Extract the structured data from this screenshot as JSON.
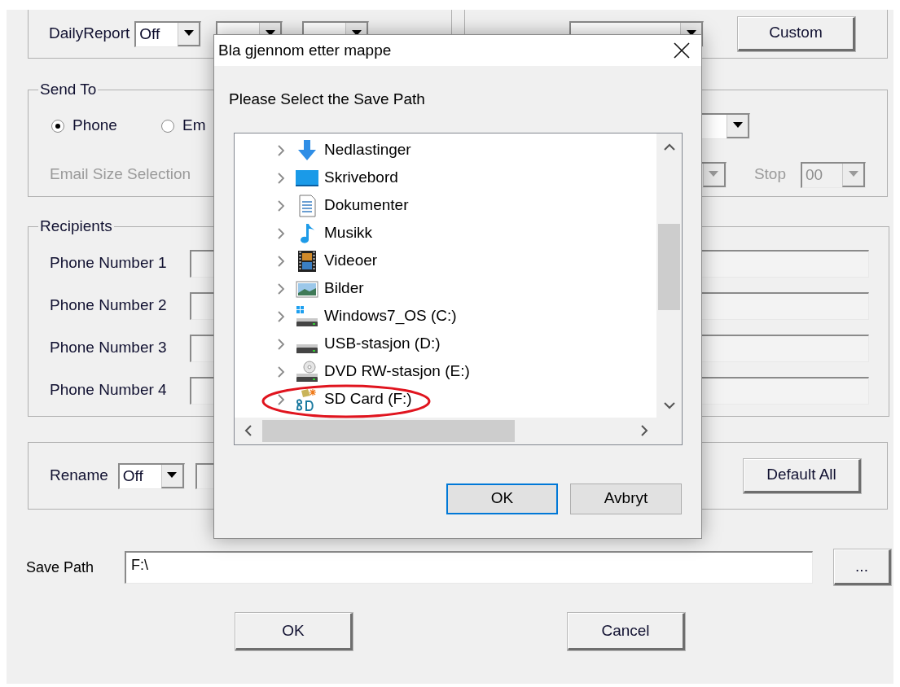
{
  "top_group": {
    "daily_report": {
      "label": "DailyReport",
      "value": "Off"
    },
    "custom_button": "Custom"
  },
  "send_to": {
    "title": "Send To",
    "options": [
      {
        "label": "Phone",
        "selected": true
      },
      {
        "label": "Em",
        "selected": false
      }
    ],
    "email_size": {
      "label": "Email Size Selection",
      "disabled": true
    },
    "stop": {
      "label": "Stop",
      "value": "00",
      "disabled": true
    }
  },
  "recipients": {
    "title": "Recipients",
    "fields": [
      {
        "label": "Phone Number 1"
      },
      {
        "label": "Phone Number 2"
      },
      {
        "label": "Phone Number 3"
      },
      {
        "label": "Phone Number 4"
      }
    ]
  },
  "rename": {
    "label": "Rename",
    "value": "Off",
    "default_all_button": "Default All"
  },
  "save_path": {
    "label": "Save Path",
    "value": "F:\\",
    "browse_button": "..."
  },
  "buttons": [
    "OK",
    "Cancel"
  ],
  "dialog": {
    "title": "Bla gjennom etter mappe",
    "prompt": "Please Select the Save Path",
    "tree": [
      {
        "label": "Nedlastinger",
        "kind": "downloads",
        "circled": false
      },
      {
        "label": "Skrivebord",
        "kind": "desktop",
        "circled": false
      },
      {
        "label": "Dokumenter",
        "kind": "documents",
        "circled": false
      },
      {
        "label": "Musikk",
        "kind": "music",
        "circled": false
      },
      {
        "label": "Videoer",
        "kind": "videos",
        "circled": false
      },
      {
        "label": "Bilder",
        "kind": "pictures",
        "circled": false
      },
      {
        "label": "Windows7_OS (C:)",
        "kind": "os-drive",
        "circled": false
      },
      {
        "label": "USB-stasjon (D:)",
        "kind": "drive",
        "circled": false
      },
      {
        "label": "DVD RW-stasjon (E:)",
        "kind": "dvd",
        "circled": false
      },
      {
        "label": "SD Card (F:)",
        "kind": "sd-card",
        "circled": true
      }
    ],
    "buttons": [
      {
        "label": "OK",
        "focused": true
      },
      {
        "label": "Avbryt",
        "focused": false
      }
    ]
  }
}
